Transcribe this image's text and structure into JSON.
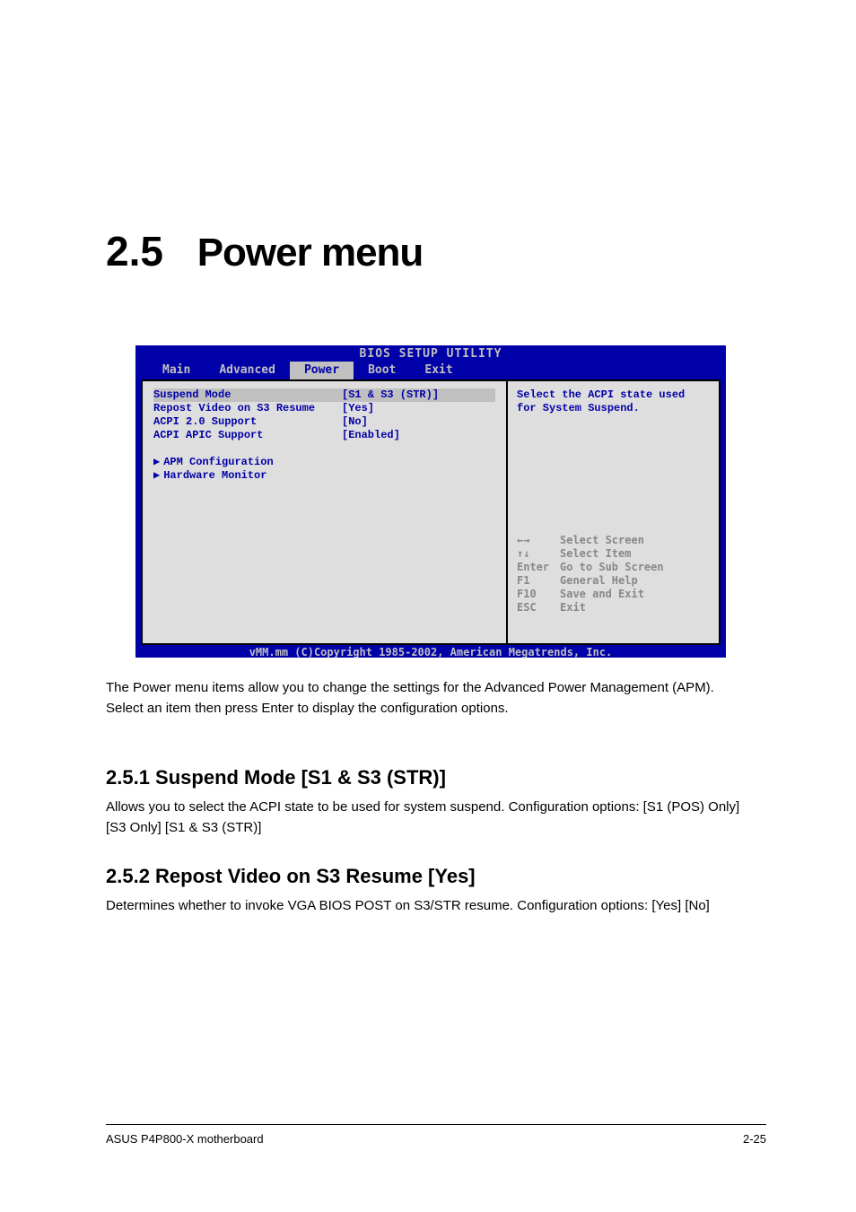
{
  "heading": {
    "num": "2.5",
    "title": "Power menu"
  },
  "bios": {
    "title": "BIOS SETUP UTILITY",
    "tabs": [
      "Main",
      "Advanced",
      "Power",
      "Boot",
      "Exit"
    ],
    "active_tab": "Power",
    "settings": [
      {
        "label": "Suspend Mode",
        "value": "[S1 & S3 (STR)]",
        "highlight": true
      },
      {
        "label": "Repost Video on S3 Resume",
        "value": "[Yes]"
      },
      {
        "label": "ACPI 2.0 Support",
        "value": "[No]"
      },
      {
        "label": "ACPI APIC Support",
        "value": "[Enabled]"
      }
    ],
    "submenus": [
      "APM Configuration",
      "Hardware Monitor"
    ],
    "help_text": "Select the ACPI state used for System Suspend.",
    "nav": [
      {
        "key": "←→",
        "desc": "Select Screen"
      },
      {
        "key": "↑↓",
        "desc": "Select Item"
      },
      {
        "key": "Enter",
        "desc": "Go to Sub Screen"
      },
      {
        "key": "F1",
        "desc": "General Help"
      },
      {
        "key": "F10",
        "desc": "Save and Exit"
      },
      {
        "key": "ESC",
        "desc": "Exit"
      }
    ],
    "footer": "vMM.mm (C)Copyright 1985-2002, American Megatrends, Inc."
  },
  "body_text": "The Power menu items allow you to change the settings for the Advanced Power Management (APM). Select an item then press Enter to display the configuration options.",
  "sub1": {
    "heading": "2.5.1  Suspend Mode [S1 & S3 (STR)]",
    "text": "Allows you to select the ACPI state to be used for system suspend. Configuration options: [S1 (POS) Only] [S3 Only] [S1 & S3 (STR)]"
  },
  "sub2": {
    "heading": "2.5.2  Repost Video on S3 Resume [Yes]",
    "text": "Determines whether to invoke VGA BIOS POST on S3/STR resume. Configuration options: [Yes] [No]"
  },
  "page_footer": {
    "left": "ASUS P4P800-X motherboard",
    "right": "2-25"
  }
}
